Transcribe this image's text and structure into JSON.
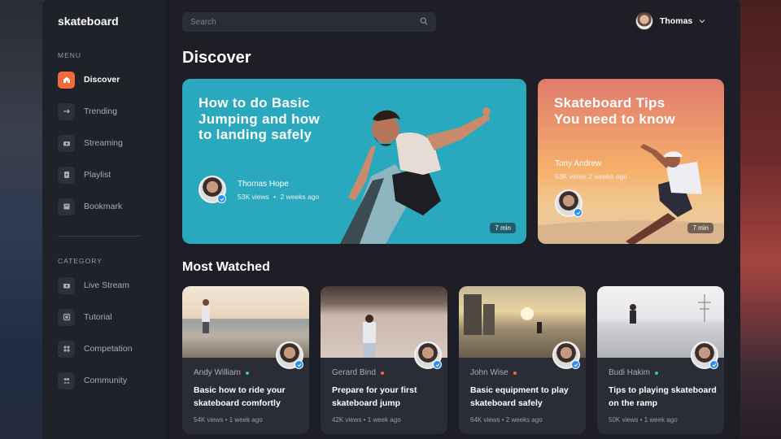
{
  "app": {
    "logo": "skateboard"
  },
  "sidebar": {
    "menu_label": "MENU",
    "menu": [
      {
        "label": "Discover",
        "icon": "home-icon",
        "active": true
      },
      {
        "label": "Trending",
        "icon": "trending-icon"
      },
      {
        "label": "Streaming",
        "icon": "streaming-icon"
      },
      {
        "label": "Playlist",
        "icon": "playlist-icon"
      },
      {
        "label": "Bookmark",
        "icon": "bookmark-icon"
      }
    ],
    "category_label": "CATEGORY",
    "categories": [
      {
        "label": "Live Stream",
        "icon": "live-stream-icon"
      },
      {
        "label": "Tutorial",
        "icon": "tutorial-icon"
      },
      {
        "label": "Competation",
        "icon": "competition-icon"
      },
      {
        "label": "Community",
        "icon": "community-icon"
      }
    ]
  },
  "header": {
    "search_placeholder": "Search",
    "user_name": "Thomas"
  },
  "main": {
    "title": "Discover",
    "featured": [
      {
        "title": "How to do Basic Jumping and how to landing safely",
        "author": "Thomas Hope",
        "views": "53K views",
        "time": "2 weeks ago",
        "duration": "7 min"
      },
      {
        "title": "Skateboard Tips You need to know",
        "author": "Tony Andrew",
        "meta": "53K views 2 weeks ago",
        "duration": "7 min"
      }
    ],
    "most_watched_title": "Most Watched",
    "videos": [
      {
        "author": "Andy William",
        "status_color": "#2ec4b6",
        "title": "Basic how to ride your skateboard comfortly",
        "views": "54K views",
        "time": "1 week ago"
      },
      {
        "author": "Gerard Bind",
        "status_color": "#f26b3a",
        "title": "Prepare for your first skateboard jump",
        "views": "42K views",
        "time": "1 week ago"
      },
      {
        "author": "John Wise",
        "status_color": "#f26b3a",
        "title": "Basic equipment to play skateboard safely",
        "views": "64K views",
        "time": "2 weeks ago"
      },
      {
        "author": "Budi Hakim",
        "status_color": "#2ec4b6",
        "title": "Tips to playing skateboard on the ramp",
        "views": "50K views",
        "time": "1 week ago"
      }
    ]
  },
  "colors": {
    "accent": "#f26b3a",
    "teal_card": "#2aa8bd",
    "verified": "#2b8ff0"
  }
}
